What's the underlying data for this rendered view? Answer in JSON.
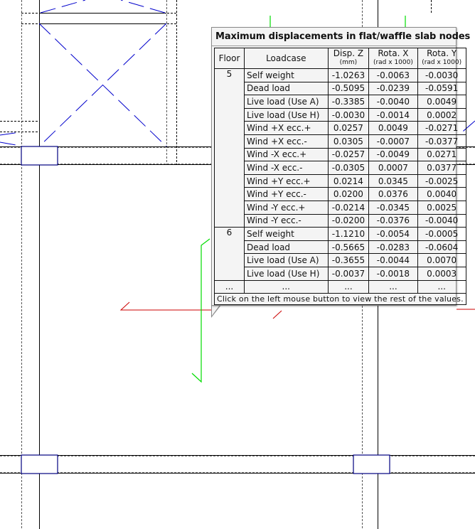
{
  "popup": {
    "title": "Maximum displacements in flat/waffle slab nodes",
    "headers": {
      "floor": "Floor",
      "loadcase": "Loadcase",
      "disp_z": "Disp. Z",
      "disp_z_unit": "(mm)",
      "rot_x": "Rota. X",
      "rot_x_unit": "(rad x 1000)",
      "rot_y": "Rota. Y",
      "rot_y_unit": "(rad x 1000)"
    },
    "groups": [
      {
        "floor": "5",
        "rows": [
          {
            "loadcase": "Self weight",
            "dz": "-1.0263",
            "rx": "-0.0063",
            "ry": "-0.0030"
          },
          {
            "loadcase": "Dead load",
            "dz": "-0.5095",
            "rx": "-0.0239",
            "ry": "-0.0591"
          },
          {
            "loadcase": "Live load (Use A)",
            "dz": "-0.3385",
            "rx": "-0.0040",
            "ry": "0.0049"
          },
          {
            "loadcase": "Live load (Use H)",
            "dz": "-0.0030",
            "rx": "-0.0014",
            "ry": "0.0002"
          },
          {
            "loadcase": "Wind +X ecc.+",
            "dz": "0.0257",
            "rx": "0.0049",
            "ry": "-0.0271"
          },
          {
            "loadcase": "Wind +X ecc.-",
            "dz": "0.0305",
            "rx": "-0.0007",
            "ry": "-0.0377"
          },
          {
            "loadcase": "Wind -X ecc.+",
            "dz": "-0.0257",
            "rx": "-0.0049",
            "ry": "0.0271"
          },
          {
            "loadcase": "Wind -X ecc.-",
            "dz": "-0.0305",
            "rx": "0.0007",
            "ry": "0.0377"
          },
          {
            "loadcase": "Wind +Y ecc.+",
            "dz": "0.0214",
            "rx": "0.0345",
            "ry": "-0.0025"
          },
          {
            "loadcase": "Wind +Y ecc.-",
            "dz": "0.0200",
            "rx": "0.0376",
            "ry": "0.0040"
          },
          {
            "loadcase": "Wind -Y ecc.+",
            "dz": "-0.0214",
            "rx": "-0.0345",
            "ry": "0.0025"
          },
          {
            "loadcase": "Wind -Y ecc.-",
            "dz": "-0.0200",
            "rx": "-0.0376",
            "ry": "-0.0040"
          }
        ]
      },
      {
        "floor": "6",
        "rows": [
          {
            "loadcase": "Self weight",
            "dz": "-1.1210",
            "rx": "-0.0054",
            "ry": "-0.0005"
          },
          {
            "loadcase": "Dead load",
            "dz": "-0.5665",
            "rx": "-0.0283",
            "ry": "-0.0604"
          },
          {
            "loadcase": "Live load (Use A)",
            "dz": "-0.3655",
            "rx": "-0.0044",
            "ry": "0.0070"
          },
          {
            "loadcase": "Live load (Use H)",
            "dz": "-0.0037",
            "rx": "-0.0018",
            "ry": "0.0003"
          }
        ]
      }
    ],
    "ellipsis": "...",
    "footer": "Click on the left mouse button to view the rest of the values."
  },
  "colors": {
    "slab_blue": "#0000cc",
    "column_blue": "#000080",
    "axis_red": "#cc0000",
    "axis_green": "#00dd00"
  }
}
